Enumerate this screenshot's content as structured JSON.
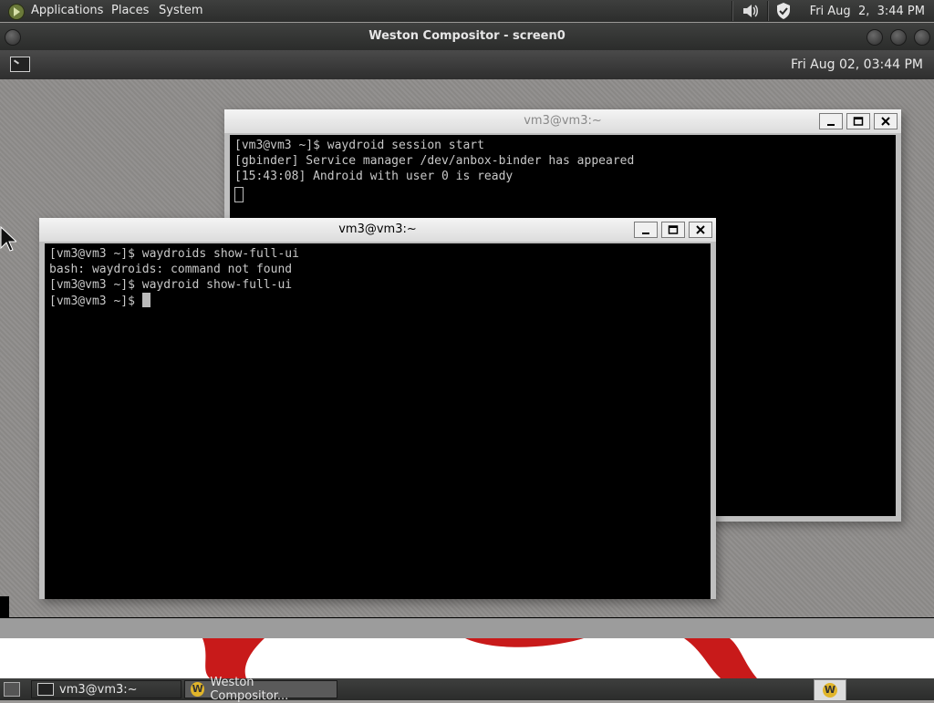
{
  "top_panel": {
    "menus": [
      "Applications",
      "Places",
      "System"
    ],
    "clock": "Fri Aug  2,  3:44 PM"
  },
  "weston": {
    "title": "Weston Compositor - screen0",
    "panel_clock": "Fri Aug 02, 03:44 PM"
  },
  "back_terminal": {
    "title": "vm3@vm3:~",
    "lines": [
      "[vm3@vm3 ~]$ waydroid session start",
      "[gbinder] Service manager /dev/anbox-binder has appeared",
      "[15:43:08] Android with user 0 is ready"
    ]
  },
  "front_terminal": {
    "title": "vm3@vm3:~",
    "lines": [
      "[vm3@vm3 ~]$ waydroids show-full-ui",
      "bash: waydroids: command not found",
      "[vm3@vm3 ~]$ waydroid show-full-ui"
    ],
    "prompt": "[vm3@vm3 ~]$ "
  },
  "taskbar": {
    "tasks": [
      "vm3@vm3:~",
      "Weston Compositor..."
    ],
    "tray_icon_letter": "W"
  },
  "colors": {
    "terminal_bg": "#000000",
    "terminal_fg": "#c8c8c8",
    "panel": "#2c2d2c"
  }
}
